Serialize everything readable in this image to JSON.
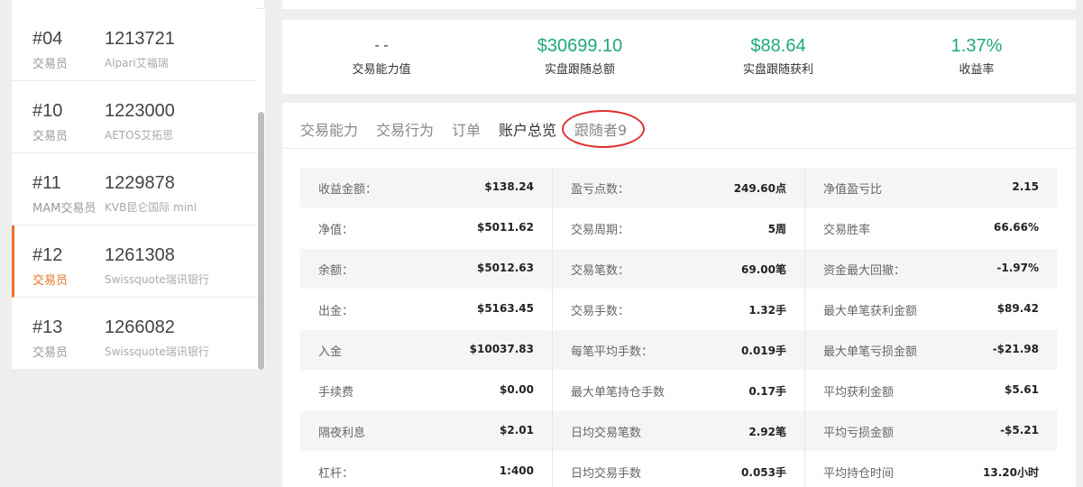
{
  "traders": [
    {
      "rank": "#04",
      "acct": "1213721",
      "role": "交易员",
      "broker": "Alpari艾福瑞",
      "active": false
    },
    {
      "rank": "#10",
      "acct": "1223000",
      "role": "交易员",
      "broker": "AETOS艾拓思",
      "active": false
    },
    {
      "rank": "#11",
      "acct": "1229878",
      "role": "MAM交易员",
      "broker": "KVB昆仑国际 mini",
      "active": false
    },
    {
      "rank": "#12",
      "acct": "1261308",
      "role": "交易员",
      "broker": "Swissquote瑞讯银行",
      "active": true
    },
    {
      "rank": "#13",
      "acct": "1266082",
      "role": "交易员",
      "broker": "Swissquote瑞讯银行",
      "active": false
    }
  ],
  "stats": [
    {
      "value": "- -",
      "label": "交易能力值"
    },
    {
      "value": "$30699.10",
      "label": "实盘跟随总额"
    },
    {
      "value": "$88.64",
      "label": "实盘跟随获利"
    },
    {
      "value": "1.37%",
      "label": "收益率"
    }
  ],
  "tabs": [
    {
      "label": "交易能力"
    },
    {
      "label": "交易行为"
    },
    {
      "label": "订单"
    },
    {
      "label": "账户总览"
    },
    {
      "label": "跟随者9"
    }
  ],
  "active_tab": "账户总览",
  "overview": {
    "col1": [
      {
        "k": "收益金额：",
        "v": "$138.24"
      },
      {
        "k": "净值：",
        "v": "$5011.62"
      },
      {
        "k": "余额：",
        "v": "$5012.63"
      },
      {
        "k": "出金：",
        "v": "$5163.45"
      },
      {
        "k": "入金",
        "v": "$10037.83"
      },
      {
        "k": "手续费",
        "v": "$0.00"
      },
      {
        "k": "隔夜利息",
        "v": "$2.01"
      },
      {
        "k": "杠杆：",
        "v": "1:400"
      }
    ],
    "col2": [
      {
        "k": "盈亏点数：",
        "v": "249.60点"
      },
      {
        "k": "交易周期：",
        "v": "5周"
      },
      {
        "k": "交易笔数：",
        "v": "69.00笔"
      },
      {
        "k": "交易手数：",
        "v": "1.32手"
      },
      {
        "k": "每笔平均手数：",
        "v": "0.019手"
      },
      {
        "k": "最大单笔持仓手数",
        "v": "0.17手"
      },
      {
        "k": "日均交易笔数",
        "v": "2.92笔"
      },
      {
        "k": "日均交易手数",
        "v": "0.053手"
      }
    ],
    "col3": [
      {
        "k": "净值盈亏比",
        "v": "2.15"
      },
      {
        "k": "交易胜率",
        "v": "66.66%"
      },
      {
        "k": "资金最大回撤：",
        "v": "-1.97%"
      },
      {
        "k": "最大单笔获利金额",
        "v": "$89.42"
      },
      {
        "k": "最大单笔亏损金额",
        "v": "-$21.98"
      },
      {
        "k": "平均获利金额",
        "v": "$5.61"
      },
      {
        "k": "平均亏损金额",
        "v": "-$5.21"
      },
      {
        "k": "平均持仓时间",
        "v": "13.20小时"
      }
    ]
  },
  "colors": {
    "accent": "#e8742b",
    "positive": "#1ea97c",
    "highlight_circle": "#e03030"
  }
}
